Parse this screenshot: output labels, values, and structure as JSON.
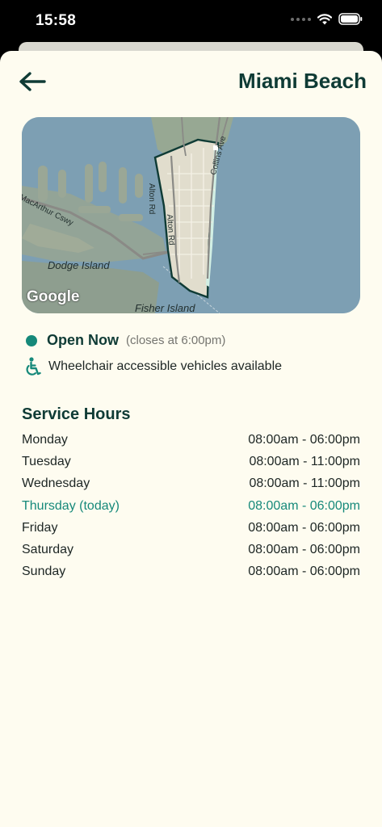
{
  "status_bar": {
    "time": "15:58"
  },
  "header": {
    "title": "Miami Beach"
  },
  "map": {
    "labels": {
      "alton_rd_1": "Alton Rd",
      "alton_rd_2": "Alton Rd",
      "collins_ave": "Collins Ave",
      "macarthur": "MacArthur Cswy",
      "dodge_island": "Dodge Island",
      "fisher_island": "Fisher Island",
      "google": "Google"
    }
  },
  "status": {
    "open_label": "Open Now",
    "closes_text": "(closes at 6:00pm)"
  },
  "accessibility": {
    "text": "Wheelchair accessible vehicles available",
    "icon": "wheelchair-icon"
  },
  "service_hours": {
    "title": "Service Hours",
    "days": [
      {
        "day": "Monday",
        "hours": "08:00am - 06:00pm",
        "today": false
      },
      {
        "day": "Tuesday",
        "hours": "08:00am - 11:00pm",
        "today": false
      },
      {
        "day": "Wednesday",
        "hours": "08:00am - 11:00pm",
        "today": false
      },
      {
        "day": "Thursday (today)",
        "hours": "08:00am - 06:00pm",
        "today": true
      },
      {
        "day": "Friday",
        "hours": "08:00am - 06:00pm",
        "today": false
      },
      {
        "day": "Saturday",
        "hours": "08:00am - 06:00pm",
        "today": false
      },
      {
        "day": "Sunday",
        "hours": "08:00am - 06:00pm",
        "today": false
      }
    ]
  },
  "colors": {
    "accent": "#16897a",
    "title": "#0f3b35",
    "background": "#fefcf0",
    "water": "#7c9fb2"
  }
}
